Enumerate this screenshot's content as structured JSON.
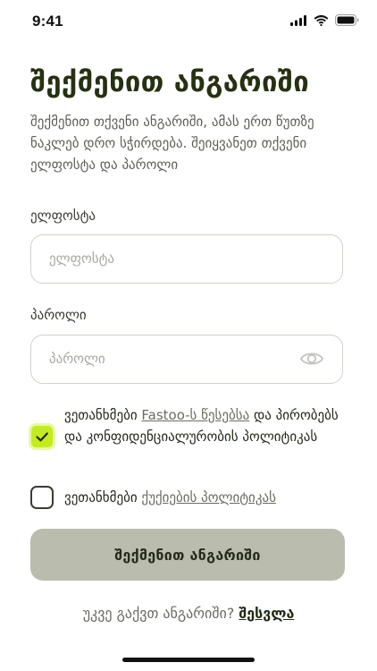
{
  "status_bar": {
    "time": "9:41",
    "icons": [
      "signal-icon",
      "wifi-icon",
      "battery-icon"
    ]
  },
  "title": "შექმენით ანგარიში",
  "subtitle": "შექმენით თქვენი ანგარიში, ამას ერთ წუთზე ნაკლებ დრო სჭირდება. შეიყვანეთ თქვენი ელფოსტა და პაროლი",
  "email": {
    "label": "ელფოსტა",
    "placeholder": "ელფოსტა",
    "value": ""
  },
  "password": {
    "label": "პაროლი",
    "placeholder": "პაროლი",
    "value": "",
    "toggle_icon": "eye-icon"
  },
  "terms": {
    "checked": true,
    "prefix": "ვეთანხმები ",
    "link": "Fastoo-ს წესებსა",
    "suffix": " და პირობებს და კონფიდენციალურობის პოლიტიკას"
  },
  "cookies": {
    "checked": false,
    "prefix": "ვეთანხმები ",
    "link": "ქუქიების პოლიტიკას"
  },
  "create_button": "შექმენით ანგარიში",
  "footer": {
    "question": "უკვე გაქვთ ანგარიში?",
    "login_link": "შესვლა"
  },
  "colors": {
    "accent_check": "#c4ec1c",
    "button_bg": "#babcad",
    "title_text": "#263112"
  }
}
